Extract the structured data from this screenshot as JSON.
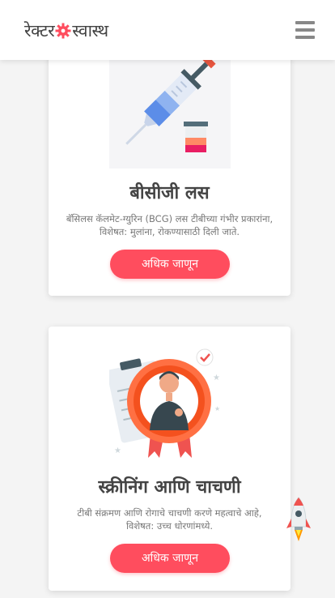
{
  "header": {
    "logo_part1": "रेक्टर",
    "logo_part2": "स्वास्थ",
    "menu_icon": "hamburger-menu-icon"
  },
  "cards": [
    {
      "title": "बीसीजी लस",
      "description": "बॅसिलस कॅलमेट-ग्युरिन (BCG) लस टीबीच्या गंभीर प्रकारांना, विशेषत: मुलांना, रोकण्यासाठी दिली जाते.",
      "button_label": "अधिक जाणून",
      "image_icon": "vaccine-syringe-icon"
    },
    {
      "title": "स्क्रीनिंग आणि चाचणी",
      "description": "टीबी संक्रमण आणि रोगाचे चाचणी करणे महत्वाचे आहे, विशेषत: उच्च धोरणांमध्ये.",
      "button_label": "अधिक जाणून",
      "image_icon": "doctor-badge-icon"
    }
  ],
  "colors": {
    "accent": "#ff4d5e",
    "gear": "#ff4d5e",
    "background": "#f4f4f4"
  },
  "scroll_to_top_icon": "rocket-icon"
}
